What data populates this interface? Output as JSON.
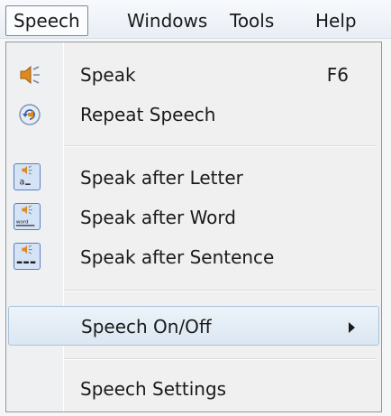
{
  "menubar": {
    "items": [
      {
        "label": "Speech"
      },
      {
        "label": "Windows"
      },
      {
        "label": "Tools"
      },
      {
        "label": "Help"
      }
    ]
  },
  "menu": {
    "speak": {
      "label": "Speak",
      "shortcut": "F6",
      "icon": "speaker-icon"
    },
    "repeat": {
      "label": "Repeat Speech",
      "icon": "repeat-speech-icon"
    },
    "after_letter": {
      "label": "Speak after Letter",
      "icon": "speak-letter-icon",
      "icon_text": "a"
    },
    "after_word": {
      "label": "Speak after Word",
      "icon": "speak-word-icon",
      "icon_text": "word"
    },
    "after_sentence": {
      "label": "Speak after Sentence",
      "icon": "speak-sentence-icon"
    },
    "onoff": {
      "label": "Speech On/Off",
      "has_submenu": true
    },
    "settings": {
      "label": "Speech Settings"
    }
  },
  "colors": {
    "highlight_border": "#aac3dc",
    "icon_box_border": "#5a7fbf",
    "icon_box_fill": "#d5e3f7",
    "speaker_orange": "#e08a1e"
  }
}
